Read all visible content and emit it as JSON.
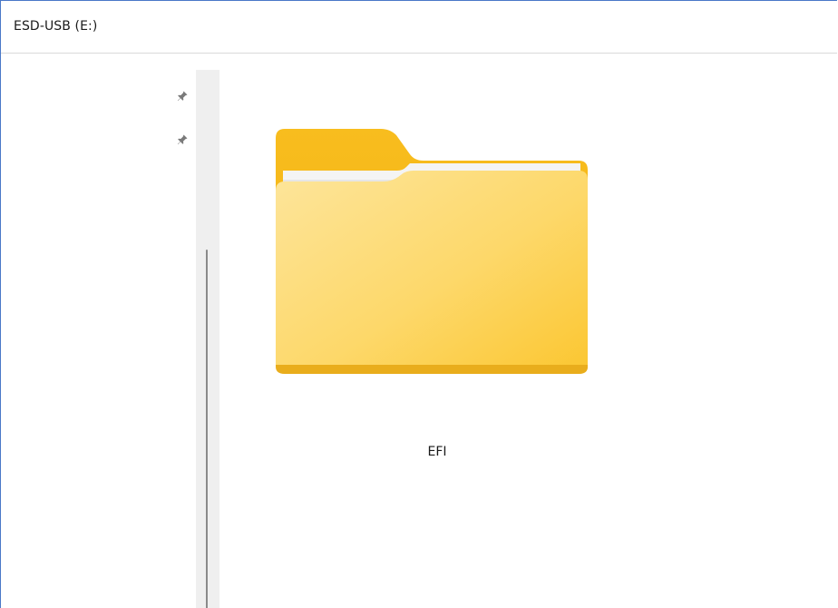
{
  "window": {
    "address_path": "ESD-USB (E:)"
  },
  "navigation_pane": {
    "pins": [
      {
        "icon": "pin-icon"
      },
      {
        "icon": "pin-icon"
      }
    ]
  },
  "content": {
    "items": [
      {
        "name": "EFI",
        "type": "folder",
        "icon": "folder-icon"
      }
    ]
  },
  "colors": {
    "folder_back": "#f6b918",
    "folder_front_light": "#fde08a",
    "folder_front_dark": "#fbc93a",
    "window_border": "#4a78c8"
  }
}
